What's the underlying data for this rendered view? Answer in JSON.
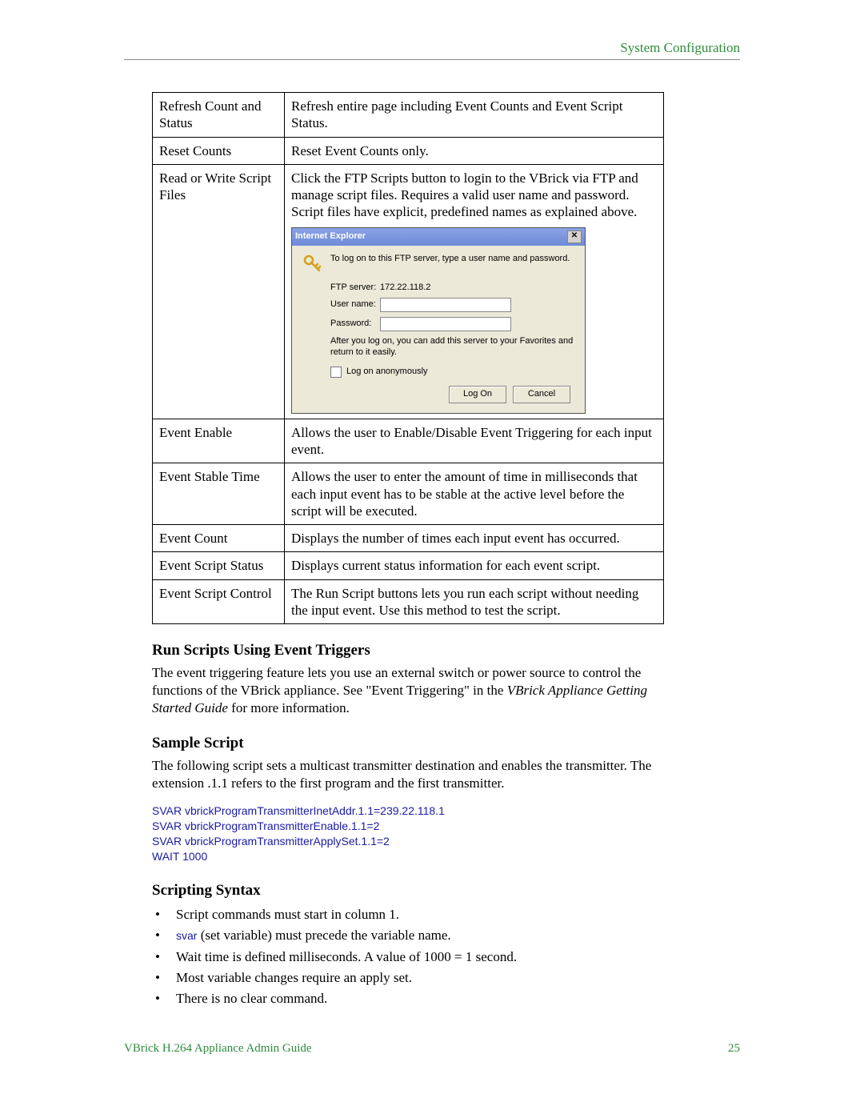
{
  "header": {
    "section": "System Configuration"
  },
  "table": {
    "r1": {
      "c1": "Refresh Count and Status",
      "c2": "Refresh entire page including Event Counts and Event Script Status."
    },
    "r2": {
      "c1": "Reset Counts",
      "c2": "Reset Event Counts only."
    },
    "r3": {
      "c1": "Read or Write Script Files",
      "c2": "Click the FTP Scripts button to login to the VBrick via FTP and manage script files. Requires a valid user name and password. Script files have explicit, predefined names as explained above."
    },
    "r4": {
      "c1": "Event Enable",
      "c2": "Allows the user to Enable/Disable Event Triggering for each input event."
    },
    "r5": {
      "c1": "Event Stable Time",
      "c2": "Allows the user to enter the amount of time in milliseconds that each input event has to be stable at the active level before the script will be executed."
    },
    "r6": {
      "c1": "Event Count",
      "c2": "Displays the number of times each input event has occurred."
    },
    "r7": {
      "c1": "Event Script Status",
      "c2": "Displays current status information for each event script."
    },
    "r8": {
      "c1": "Event Script Control",
      "c2": "The Run Script buttons lets you run each script without needing the input event. Use this method to test the script."
    }
  },
  "dialog": {
    "title": "Internet Explorer",
    "close": "✕",
    "line1": "To log on to this FTP server, type a user name and password.",
    "ftp_label": "FTP server:",
    "ftp_value": "172.22.118.2",
    "user_label": "User name:",
    "pass_label": "Password:",
    "note": "After you log on, you can add this server to your Favorites and return to it easily.",
    "anon": "Log on anonymously",
    "logon_btn": "Log On",
    "cancel_btn": "Cancel"
  },
  "sec1": {
    "title": "Run Scripts Using Event Triggers",
    "p_a": "The event triggering feature lets you use an external switch or power source to control the functions of the VBrick appliance. See \"Event Triggering\" in the ",
    "p_b": "VBrick Appliance Getting Started Guide",
    "p_c": " for more information."
  },
  "sec2": {
    "title": "Sample Script",
    "p": "The following script sets a multicast transmitter destination and enables the transmitter. The extension .1.1 refers to the first program and the first transmitter.",
    "code": "SVAR vbrickProgramTransmitterInetAddr.1.1=239.22.118.1\nSVAR vbrickProgramTransmitterEnable.1.1=2\nSVAR vbrickProgramTransmitterApplySet.1.1=2\nWAIT 1000"
  },
  "sec3": {
    "title": "Scripting Syntax",
    "b1": "Script commands must start in column 1.",
    "b2a": "svar",
    "b2b": " (set variable) must precede the variable name.",
    "b3": "Wait time is defined milliseconds. A value of 1000 = 1 second.",
    "b4": "Most variable changes require an apply set.",
    "b5": "There is no clear command."
  },
  "footer": {
    "left": "VBrick H.264 Appliance Admin Guide",
    "right": "25"
  }
}
